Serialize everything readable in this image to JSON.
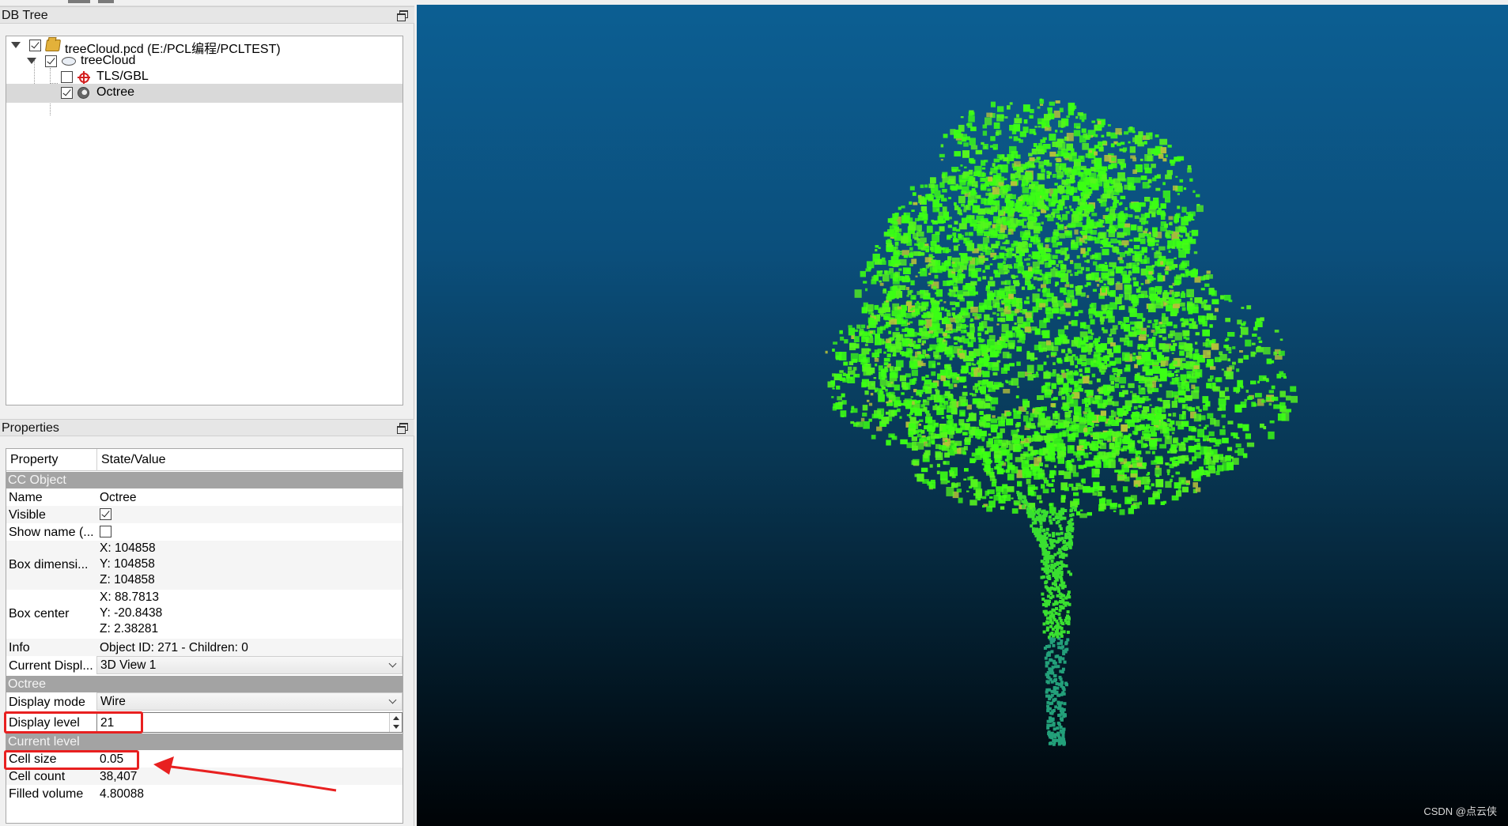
{
  "db_tree": {
    "title": "DB Tree",
    "items": [
      {
        "label": "treeCloud.pcd (E:/PCL编程/PCLTEST)",
        "icon": "folder-icon",
        "checked": true,
        "expanded": true
      },
      {
        "label": "treeCloud",
        "icon": "point-cloud-icon",
        "checked": true,
        "expanded": true
      },
      {
        "label": "TLS/GBL",
        "icon": "target-icon",
        "checked": false
      },
      {
        "label": "Octree",
        "icon": "octree-icon",
        "checked": true,
        "selected": true
      }
    ]
  },
  "properties": {
    "title": "Properties",
    "col_property": "Property",
    "col_value": "State/Value",
    "sections": {
      "cc_object": "CC Object",
      "octree": "Octree",
      "current_level": "Current level"
    },
    "name": {
      "key": "Name",
      "value": "Octree"
    },
    "visible": {
      "key": "Visible",
      "checked": true
    },
    "show_name": {
      "key": "Show name (...",
      "checked": false
    },
    "box_dims": {
      "key": "Box dimensi...",
      "x": "X: 104858",
      "y": "Y: 104858",
      "z": "Z: 104858"
    },
    "box_center": {
      "key": "Box center",
      "x": "X: 88.7813",
      "y": "Y: -20.8438",
      "z": "Z: 2.38281"
    },
    "info": {
      "key": "Info",
      "value": "Object ID: 271 - Children: 0"
    },
    "current_display": {
      "key": "Current Displ...",
      "value": "3D View 1"
    },
    "display_mode": {
      "key": "Display mode",
      "value": "Wire"
    },
    "display_level": {
      "key": "Display level",
      "value": "21"
    },
    "cell_size": {
      "key": "Cell size",
      "value": "0.05"
    },
    "cell_count": {
      "key": "Cell count",
      "value": "38,407"
    },
    "filled_volume": {
      "key": "Filled volume",
      "value": "4.80088"
    }
  },
  "view3d": {
    "watermark": "CSDN @点云侠"
  },
  "colors": {
    "accent_highlight": "#e82020",
    "tree_green": "#3cff14",
    "background_top": "#0c5f93",
    "background_bottom": "#000306"
  }
}
